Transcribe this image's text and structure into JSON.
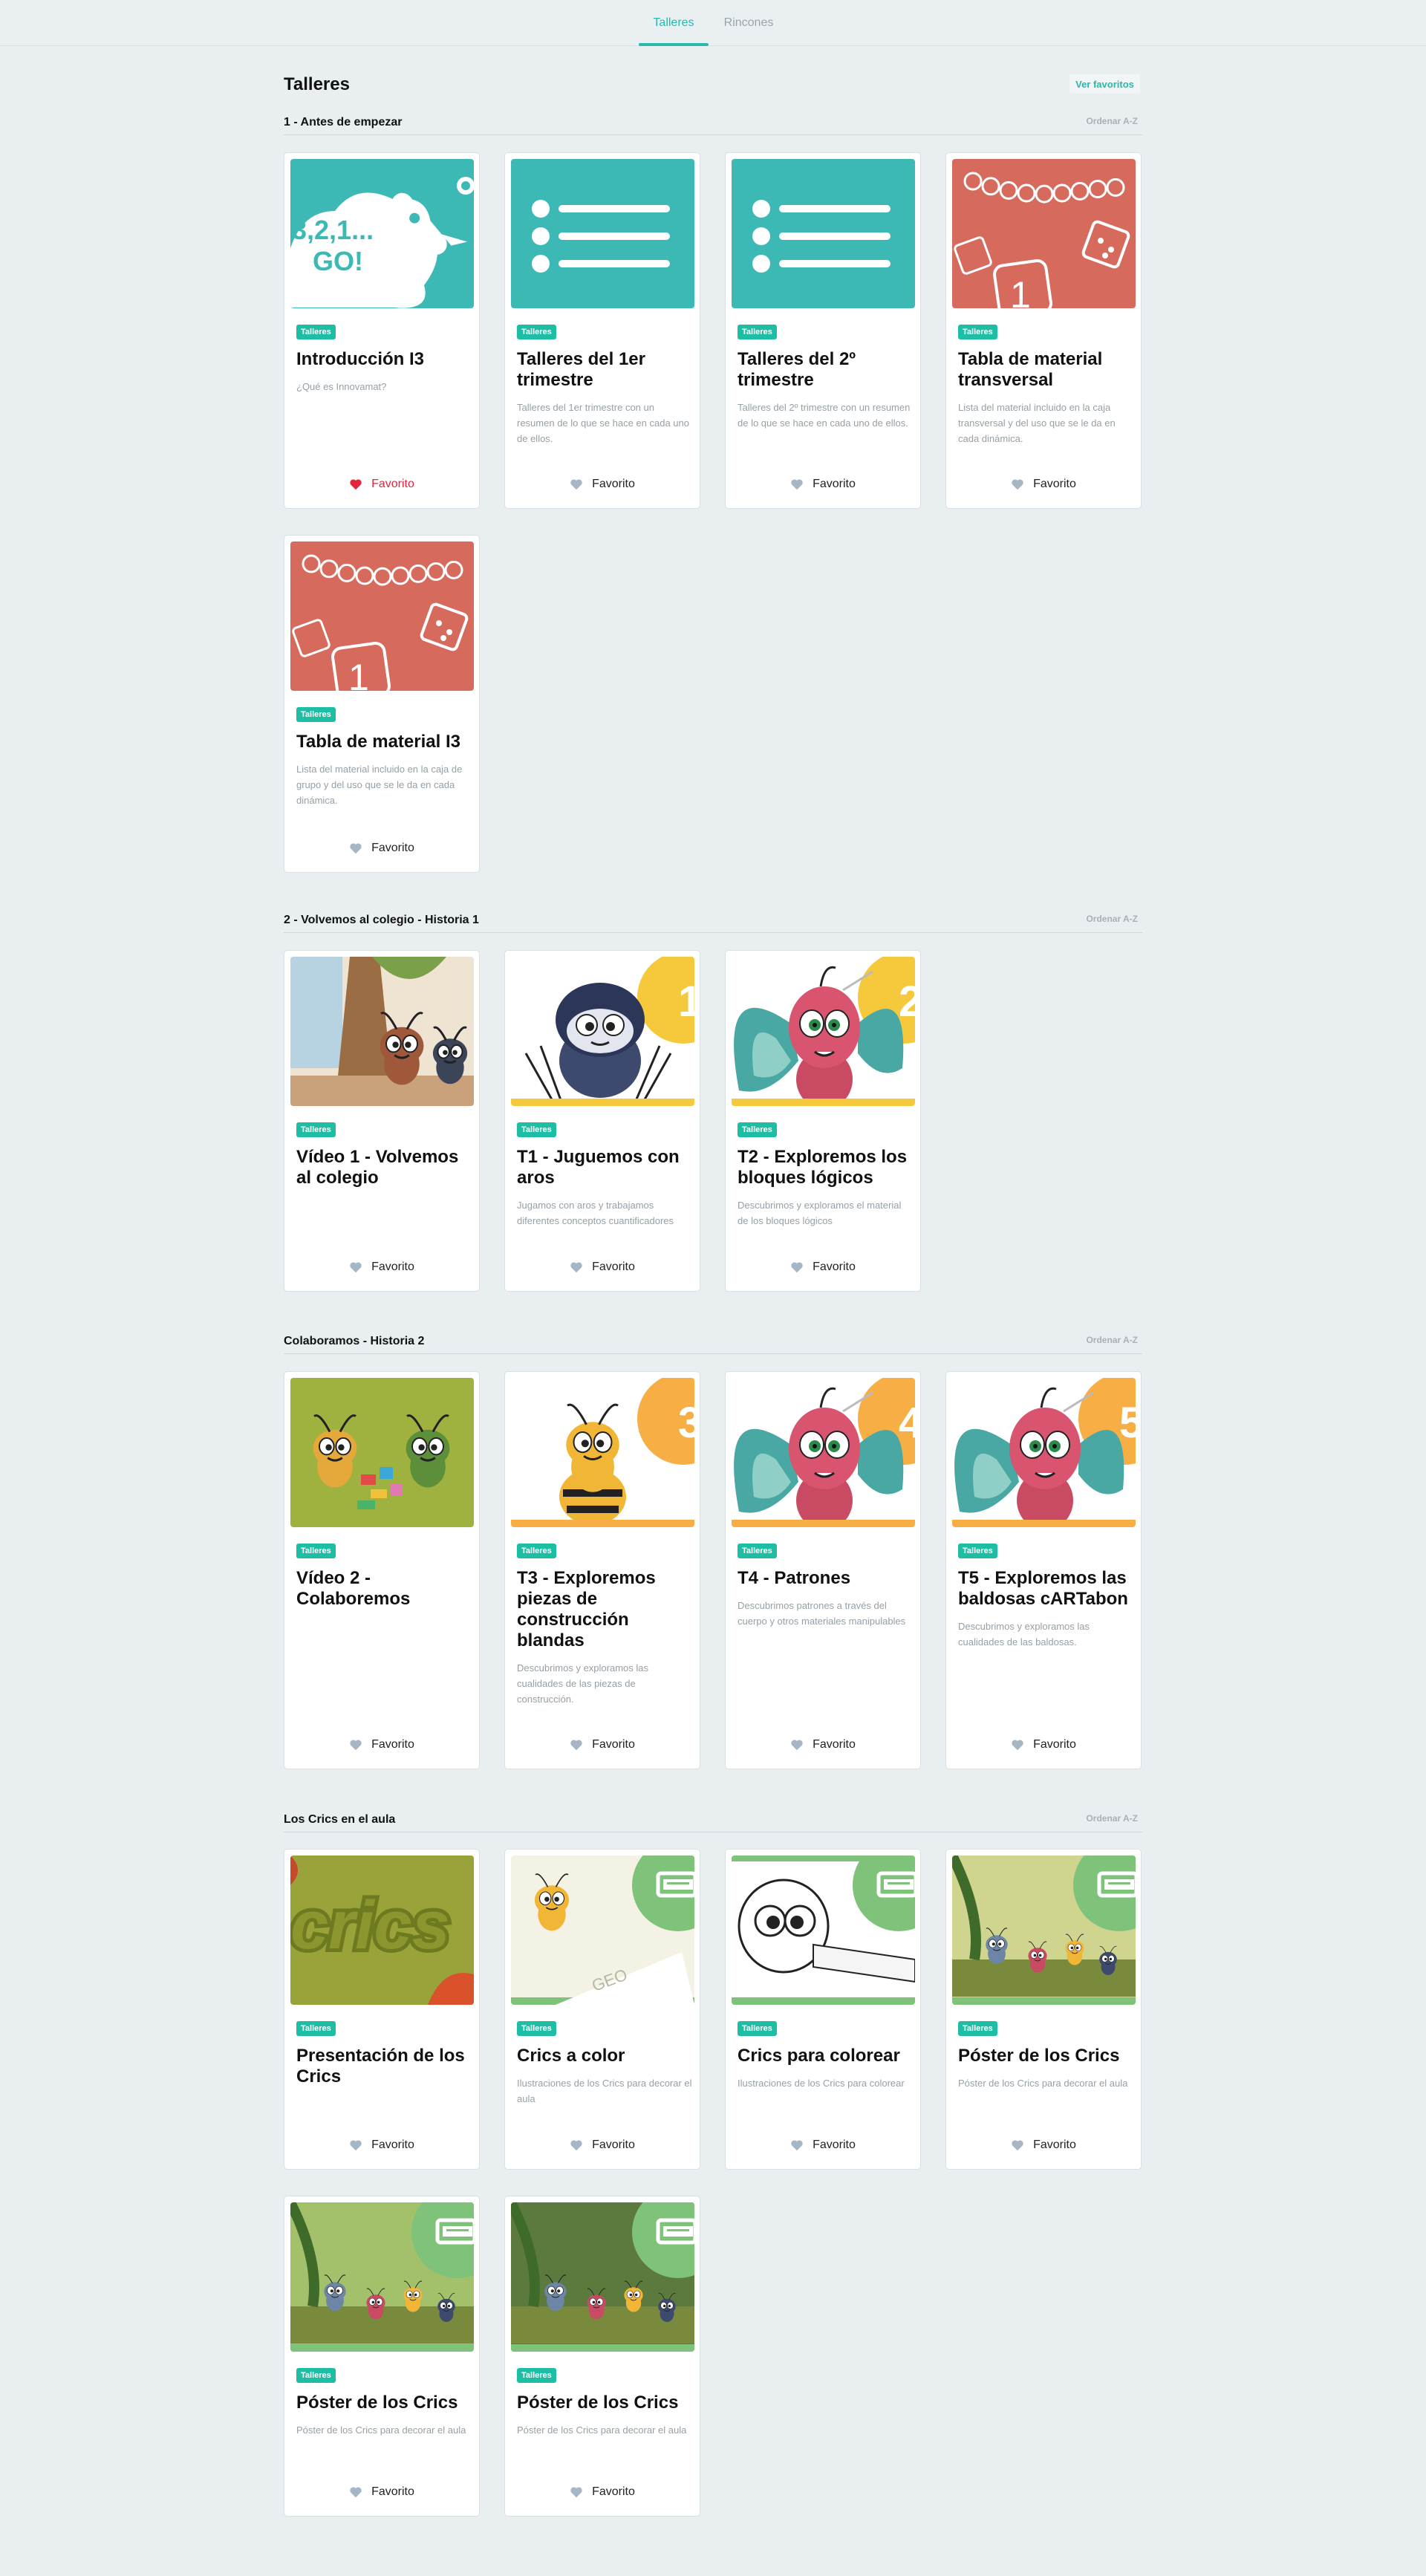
{
  "nav": {
    "tabs": [
      {
        "label": "Talleres",
        "active": true
      },
      {
        "label": "Rincones",
        "active": false
      }
    ]
  },
  "header": {
    "title": "Talleres",
    "favorites_link": "Ver favoritos"
  },
  "sort_label": "Ordenar A-Z",
  "fav_label": "Favorito",
  "badge_label": "Talleres",
  "colors": {
    "accent": "#29b9aa",
    "badge": "#1ebea5",
    "teal_thumb": "#3cb9b4",
    "coral_thumb": "#d66a5c",
    "yellow_circle": "#f5c93b",
    "orange_circle": "#f7ae45",
    "green_circle": "#7fc27a",
    "heart_on": "#e0263c",
    "heart_off": "#a7b6c4"
  },
  "sections": [
    {
      "title": "1 - Antes de empezar",
      "cards": [
        {
          "title": "Introducción I3",
          "desc": "¿Qué es Innovamat?",
          "thumb": "rocket",
          "favorite": true
        },
        {
          "title": "Talleres del 1er trimestre",
          "desc": "Talleres del 1er trimestre con un resumen de lo que se hace en cada uno de ellos.",
          "thumb": "list",
          "favorite": false
        },
        {
          "title": "Talleres del 2º trimestre",
          "desc": "Talleres del 2º trimestre con un resumen de lo que se hace en cada uno de ellos.",
          "thumb": "list",
          "favorite": false
        },
        {
          "title": "Tabla de material transversal",
          "desc": "Lista del material incluido en la caja transversal y del uso que se le da en cada dinámica.",
          "thumb": "material",
          "favorite": false
        },
        {
          "title": "Tabla de material I3",
          "desc": "Lista del material incluido en la caja de grupo y del uso que se le da en cada dinámica.",
          "thumb": "material",
          "favorite": false
        }
      ]
    },
    {
      "title": "2 - Volvemos al colegio - Historia 1",
      "cards": [
        {
          "title": "Vídeo 1 - Volvemos al colegio",
          "desc": "",
          "thumb": "scene-school",
          "favorite": false
        },
        {
          "title": "T1 - Juguemos con aros",
          "desc": "Jugamos con aros y trabajamos diferentes conceptos cuantificadores",
          "thumb": "bug-spider",
          "number": "1",
          "favorite": false
        },
        {
          "title": "T2 - Exploremos los bloques lógicos",
          "desc": "Descubrimos y exploramos el material de los bloques lógicos",
          "thumb": "bug-butterfly",
          "number": "2",
          "favorite": false
        }
      ]
    },
    {
      "title": "Colaboramos - Historia 2",
      "cards": [
        {
          "title": "Vídeo 2 - Colaboremos",
          "desc": "",
          "thumb": "scene-collab",
          "favorite": false
        },
        {
          "title": "T3 - Exploremos piezas de construcción blandas",
          "desc": "Descubrimos y exploramos las cualidades de las piezas de construcción.",
          "thumb": "bug-bee",
          "number": "3",
          "favorite": false
        },
        {
          "title": "T4 - Patrones",
          "desc": "Descubrimos patrones a través del cuerpo y otros materiales manipulables",
          "thumb": "bug-butterfly-o",
          "number": "4",
          "favorite": false
        },
        {
          "title": "T5 - Exploremos las baldosas cARTabon",
          "desc": "Descubrimos y exploramos las cualidades de las baldosas.",
          "thumb": "bug-butterfly-o",
          "number": "5",
          "favorite": false
        }
      ]
    },
    {
      "title": "Los Crics en el aula",
      "cards": [
        {
          "title": "Presentación de los Crics",
          "desc": "",
          "thumb": "crics-logo",
          "favorite": false
        },
        {
          "title": "Crics a color",
          "desc": "Ilustraciones de los Crics para decorar el aula",
          "thumb": "print-bee",
          "favorite": false
        },
        {
          "title": "Crics para colorear",
          "desc": "Ilustraciones de los Crics para colorear",
          "thumb": "print-outline",
          "favorite": false
        },
        {
          "title": "Póster de los Crics",
          "desc": "Póster de los Crics para decorar el aula",
          "thumb": "print-poster",
          "favorite": false
        },
        {
          "title": "Póster de los Crics",
          "desc": "Póster de los Crics para decorar el aula",
          "thumb": "print-poster2",
          "favorite": false
        },
        {
          "title": "Póster de los Crics",
          "desc": "Póster de los Crics para decorar el aula",
          "thumb": "print-poster3",
          "favorite": false
        }
      ]
    }
  ]
}
